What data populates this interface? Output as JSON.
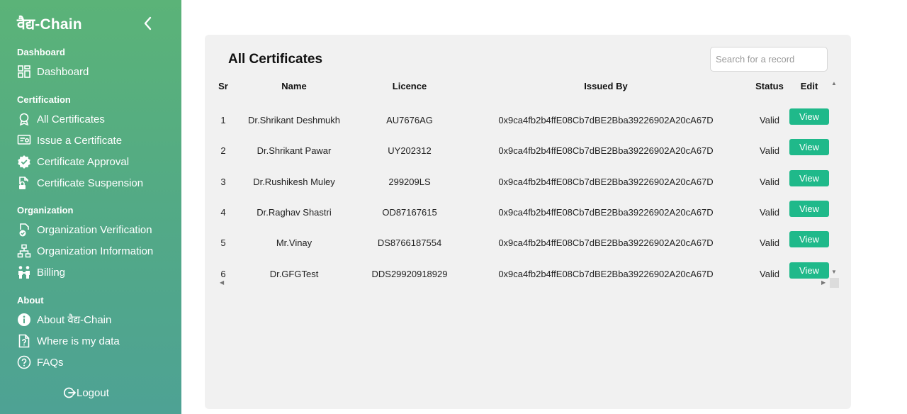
{
  "sidebar": {
    "brand": "वैद्य-Chain",
    "sections": [
      {
        "title": "Dashboard",
        "items": [
          {
            "label": "Dashboard",
            "icon": "dashboard-grid-icon"
          }
        ]
      },
      {
        "title": "Certification",
        "items": [
          {
            "label": "All Certificates",
            "icon": "award-icon"
          },
          {
            "label": "Issue a Certificate",
            "icon": "certificate-icon"
          },
          {
            "label": "Certificate Approval",
            "icon": "verified-badge-icon"
          },
          {
            "label": "Certificate Suspension",
            "icon": "file-lock-icon"
          }
        ]
      },
      {
        "title": "Organization",
        "items": [
          {
            "label": "Organization Verification",
            "icon": "org-verify-icon"
          },
          {
            "label": "Organization Information",
            "icon": "org-chart-icon"
          },
          {
            "label": "Billing",
            "icon": "billing-icon"
          }
        ]
      },
      {
        "title": "About",
        "items": [
          {
            "label": "About वैद्य-Chain",
            "icon": "info-icon"
          },
          {
            "label": "Where is my data",
            "icon": "file-question-icon"
          },
          {
            "label": "FAQs",
            "icon": "question-circle-icon"
          }
        ]
      }
    ],
    "logout": "Logout"
  },
  "main": {
    "title": "All Certificates",
    "search_placeholder": "Search for a record",
    "columns": {
      "sr": "Sr",
      "name": "Name",
      "licence": "Licence",
      "issued_by": "Issued By",
      "status": "Status",
      "edit": "Edit"
    },
    "rows": [
      {
        "sr": "1",
        "name": "Dr.Shrikant Deshmukh",
        "licence": "AU7676AG",
        "issued_by": "0x9ca4fb2b4ffE08Cb7dBE2Bba39226902A20cA67D",
        "status": "Valid",
        "action": "View"
      },
      {
        "sr": "2",
        "name": "Dr.Shrikant Pawar",
        "licence": "UY202312",
        "issued_by": "0x9ca4fb2b4ffE08Cb7dBE2Bba39226902A20cA67D",
        "status": "Valid",
        "action": "View"
      },
      {
        "sr": "3",
        "name": "Dr.Rushikesh Muley",
        "licence": "299209LS",
        "issued_by": "0x9ca4fb2b4ffE08Cb7dBE2Bba39226902A20cA67D",
        "status": "Valid",
        "action": "View"
      },
      {
        "sr": "4",
        "name": "Dr.Raghav Shastri",
        "licence": "OD87167615",
        "issued_by": "0x9ca4fb2b4ffE08Cb7dBE2Bba39226902A20cA67D",
        "status": "Valid",
        "action": "View"
      },
      {
        "sr": "5",
        "name": "Mr.Vinay",
        "licence": "DS8766187554",
        "issued_by": "0x9ca4fb2b4ffE08Cb7dBE2Bba39226902A20cA67D",
        "status": "Valid",
        "action": "View"
      },
      {
        "sr": "6",
        "name": "Dr.GFGTest",
        "licence": "DDS29920918929",
        "issued_by": "0x9ca4fb2b4ffE08Cb7dBE2Bba39226902A20cA67D",
        "status": "Valid",
        "action": "View"
      }
    ]
  },
  "colors": {
    "sidebar_top": "#5bb378",
    "sidebar_bottom": "#4ea294",
    "view_button": "#1fb98a",
    "card_bg": "#f1f1f1"
  }
}
